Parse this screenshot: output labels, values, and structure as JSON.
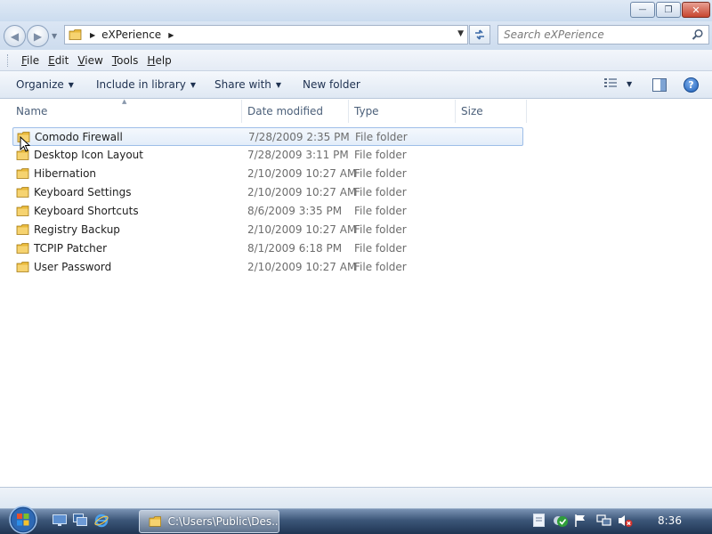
{
  "window": {
    "controls": {
      "minimize_glyph": "—",
      "maximize_glyph": "❐",
      "close_glyph": "✕"
    }
  },
  "navigation": {
    "back_glyph": "◀",
    "forward_glyph": "▶",
    "address_folder": "eXPerience",
    "search_placeholder": "Search eXPerience"
  },
  "menubar": {
    "items": [
      {
        "accel": "F",
        "rest": "ile"
      },
      {
        "accel": "E",
        "rest": "dit"
      },
      {
        "accel": "V",
        "rest": "iew"
      },
      {
        "accel": "T",
        "rest": "ools"
      },
      {
        "accel": "H",
        "rest": "elp"
      }
    ]
  },
  "commandbar": {
    "organize": "Organize",
    "include_in_library": "Include in library",
    "share_with": "Share with",
    "new_folder": "New folder",
    "help_glyph": "?"
  },
  "columns": {
    "name": "Name",
    "date_modified": "Date modified",
    "type": "Type",
    "size": "Size"
  },
  "files": [
    {
      "name": "Comodo Firewall",
      "date": "7/28/2009 2:35 PM",
      "type": "File folder"
    },
    {
      "name": "Desktop Icon Layout",
      "date": "7/28/2009 3:11 PM",
      "type": "File folder"
    },
    {
      "name": "Hibernation",
      "date": "2/10/2009 10:27 AM",
      "type": "File folder"
    },
    {
      "name": "Keyboard Settings",
      "date": "2/10/2009 10:27 AM",
      "type": "File folder"
    },
    {
      "name": "Keyboard Shortcuts",
      "date": "8/6/2009 3:35 PM",
      "type": "File folder"
    },
    {
      "name": "Registry Backup",
      "date": "2/10/2009 10:27 AM",
      "type": "File folder"
    },
    {
      "name": "TCPIP Patcher",
      "date": "8/1/2009 6:18 PM",
      "type": "File folder"
    },
    {
      "name": "User Password",
      "date": "2/10/2009 10:27 AM",
      "type": "File folder"
    }
  ],
  "taskbar": {
    "task_label": "C:\\Users\\Public\\Des...",
    "clock": "8:36"
  },
  "colors": {
    "accent": "#3b6aa8",
    "selection_border": "#9ebee8",
    "folder_yellow": "#f2c94c"
  },
  "icons": [
    "folder-icon",
    "search-icon",
    "refresh-icon",
    "views-icon",
    "preview-pane-icon",
    "help-icon",
    "start-orb-icon",
    "cursor-icon"
  ]
}
